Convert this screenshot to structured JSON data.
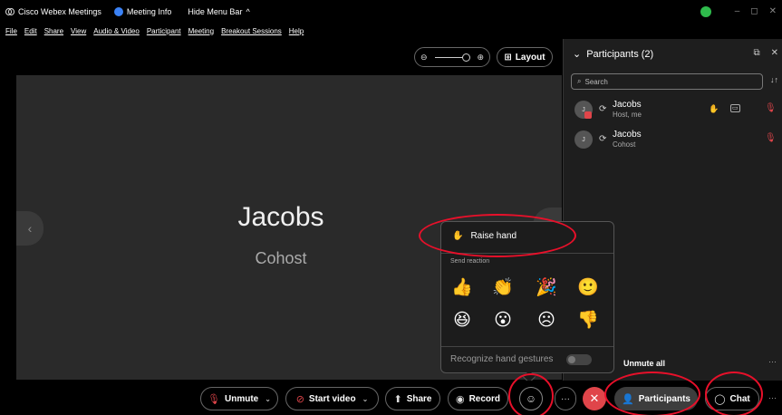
{
  "titlebar": {
    "app_name": "Cisco Webex Meetings",
    "meeting_info": "Meeting Info",
    "hide_menu_bar": "Hide Menu Bar",
    "chevron": "^",
    "min": "–",
    "restore": "◻",
    "close": "✕"
  },
  "menu": [
    "File",
    "Edit",
    "Share",
    "View",
    "Audio & Video",
    "Participant",
    "Meeting",
    "Breakout Sessions",
    "Help"
  ],
  "stage": {
    "name": "Jacobs",
    "role": "Cohost",
    "nav_left": "‹"
  },
  "zoom": {
    "minus": "⊖",
    "plus": "⊕"
  },
  "layout": {
    "icon": "⊞",
    "label": "Layout"
  },
  "participants_panel": {
    "title": "Participants (2)",
    "search_placeholder": "Search",
    "sort_icon": "↓↑",
    "participants": [
      {
        "initial": "J",
        "name": "Jacobs",
        "role": "Host, me"
      },
      {
        "initial": "J",
        "name": "Jacobs",
        "role": "Cohost"
      }
    ],
    "unmute_all": "Unmute all",
    "more": "···"
  },
  "reaction_popup": {
    "raise_hand": "Raise hand",
    "send_reaction": "Send reaction",
    "reactions": [
      "👍",
      "👏",
      "🎉",
      "🙂",
      "😆",
      "😮",
      "☹",
      "👎"
    ],
    "recognize_gestures": "Recognize hand gestures"
  },
  "toolbar": {
    "unmute": "Unmute",
    "start_video": "Start video",
    "share": "Share",
    "record": "Record",
    "more": "···",
    "participants": "Participants",
    "chat": "Chat",
    "overflow": "···",
    "end": "✕"
  },
  "colors": {
    "accent_red": "#e0454a",
    "annotation_red": "#e8102a",
    "panel_bg": "#1e1e1e",
    "video_bg": "#2a2a2a"
  }
}
